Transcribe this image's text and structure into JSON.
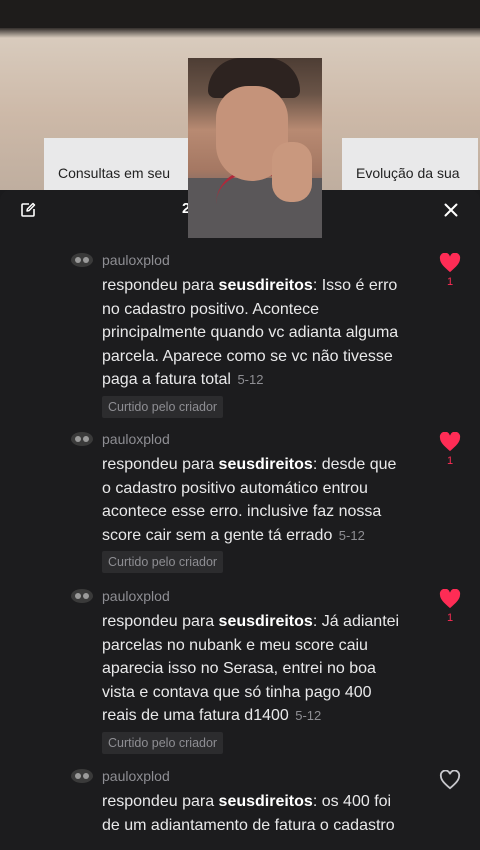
{
  "video": {
    "card_left_text": "Consultas em seu",
    "card_right_text": "Evolução da sua"
  },
  "panel": {
    "comment_count": "2"
  },
  "comments": [
    {
      "username": "pauloxplod",
      "reply_prefix": "respondeu para",
      "reply_to": "seusdireitos",
      "body": ": Isso é erro no cadastro positivo. Acontece principalmente quando vc adianta alguma parcela. Aparece como se vc não tivesse paga a fatura total",
      "date": "5-12",
      "badge": "Curtido pelo criador",
      "likes": "1",
      "liked": true
    },
    {
      "username": "pauloxplod",
      "reply_prefix": "respondeu para",
      "reply_to": "seusdireitos",
      "body": ": desde que o cadastro positivo automático entrou acontece esse erro. inclusive faz nossa score cair sem a gente tá errado",
      "date": "5-12",
      "badge": "Curtido pelo criador",
      "likes": "1",
      "liked": true
    },
    {
      "username": "pauloxplod",
      "reply_prefix": "respondeu para",
      "reply_to": "seusdireitos",
      "body": ": Já adiantei parcelas no nubank e meu score caiu aparecia isso no Serasa, entrei no boa vista e contava que só tinha pago 400 reais de uma fatura d1400",
      "date": "5-12",
      "badge": "Curtido pelo criador",
      "likes": "1",
      "liked": true
    },
    {
      "username": "pauloxplod",
      "reply_prefix": "respondeu para",
      "reply_to": "seusdireitos",
      "body": ": os 400 foi de um adiantamento de fatura o cadastro",
      "liked": false
    }
  ],
  "colors": {
    "like_red": "#fe2c55",
    "panel_bg": "#1c1c1e",
    "muted_text": "#8e8e93"
  }
}
